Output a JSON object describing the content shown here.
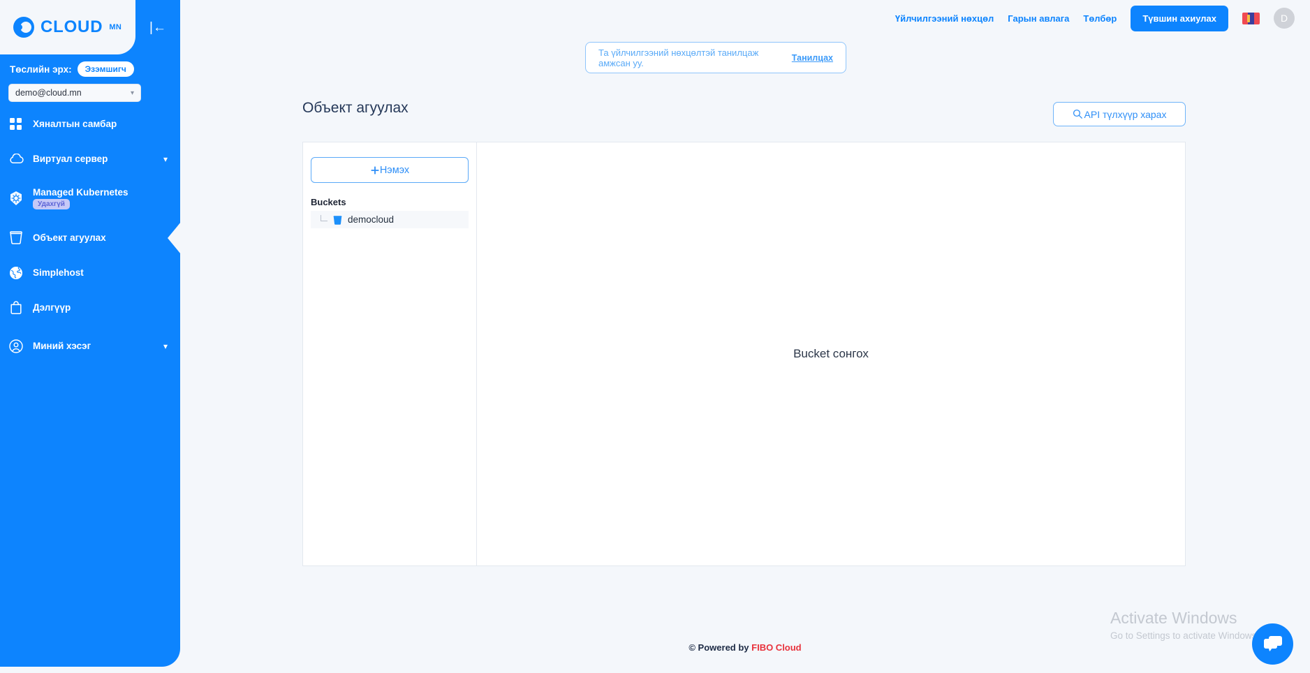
{
  "sidebar": {
    "logo": {
      "word": "CLOUD",
      "sup": "MN",
      "icon": "cloud-logo-icon"
    },
    "collapse_glyph": "|←",
    "role_label": "Төслийн эрх:",
    "role_value": "Эзэмшигч",
    "project_value": "demo@cloud.mn",
    "items": [
      {
        "label": "Хяналтын самбар",
        "icon": "grid-icon",
        "badge": "",
        "chevron": false,
        "active": false
      },
      {
        "label": "Виртуал сервер",
        "icon": "cloud-icon",
        "badge": "",
        "chevron": true,
        "active": false
      },
      {
        "label": "Managed Kubernetes",
        "icon": "kubernetes-icon",
        "badge": "Удахгүй",
        "chevron": false,
        "active": false
      },
      {
        "label": "Объект агуулах",
        "icon": "bucket-icon",
        "badge": "",
        "chevron": false,
        "active": true
      },
      {
        "label": "Simplehost",
        "icon": "globe-icon",
        "badge": "",
        "chevron": false,
        "active": false
      },
      {
        "label": "Дэлгүүр",
        "icon": "shop-bag-icon",
        "badge": "",
        "chevron": false,
        "active": false
      },
      {
        "label": "Миний хэсэг",
        "icon": "user-circle-icon",
        "badge": "",
        "chevron": true,
        "active": false
      }
    ]
  },
  "topbar": {
    "links": [
      "Үйлчилгээний нөхцөл",
      "Гарын авлага",
      "Төлбөр"
    ],
    "upgrade_label": "Түвшин ахиулах",
    "flag": "mongolia-flag-icon",
    "avatar_initial": "D"
  },
  "notice": {
    "message": "Та үйлчилгээний нөхцөлтэй танилцаж амжсан уу.",
    "action": "Танилцах"
  },
  "page": {
    "title": "Объект агуулах",
    "api_button": "API түлхүүр харах"
  },
  "card": {
    "add_button": "Нэмэх",
    "pane_heading": "Buckets",
    "buckets": [
      "democloud"
    ],
    "empty_message": "Bucket сонгох"
  },
  "footer": {
    "prefix": "© Powered by ",
    "brand": "FIBO Cloud"
  },
  "watermark": {
    "line1": "Activate Windows",
    "line2": "Go to Settings to activate Windows."
  },
  "chat": {
    "icon": "chat-bubble-icon"
  },
  "colors": {
    "brand_blue": "#0d84fe",
    "page_bg": "#f4f7fb",
    "badge_bg": "#c6c9f7",
    "badge_text": "#5b63d6",
    "brand_red": "#e8323c"
  }
}
